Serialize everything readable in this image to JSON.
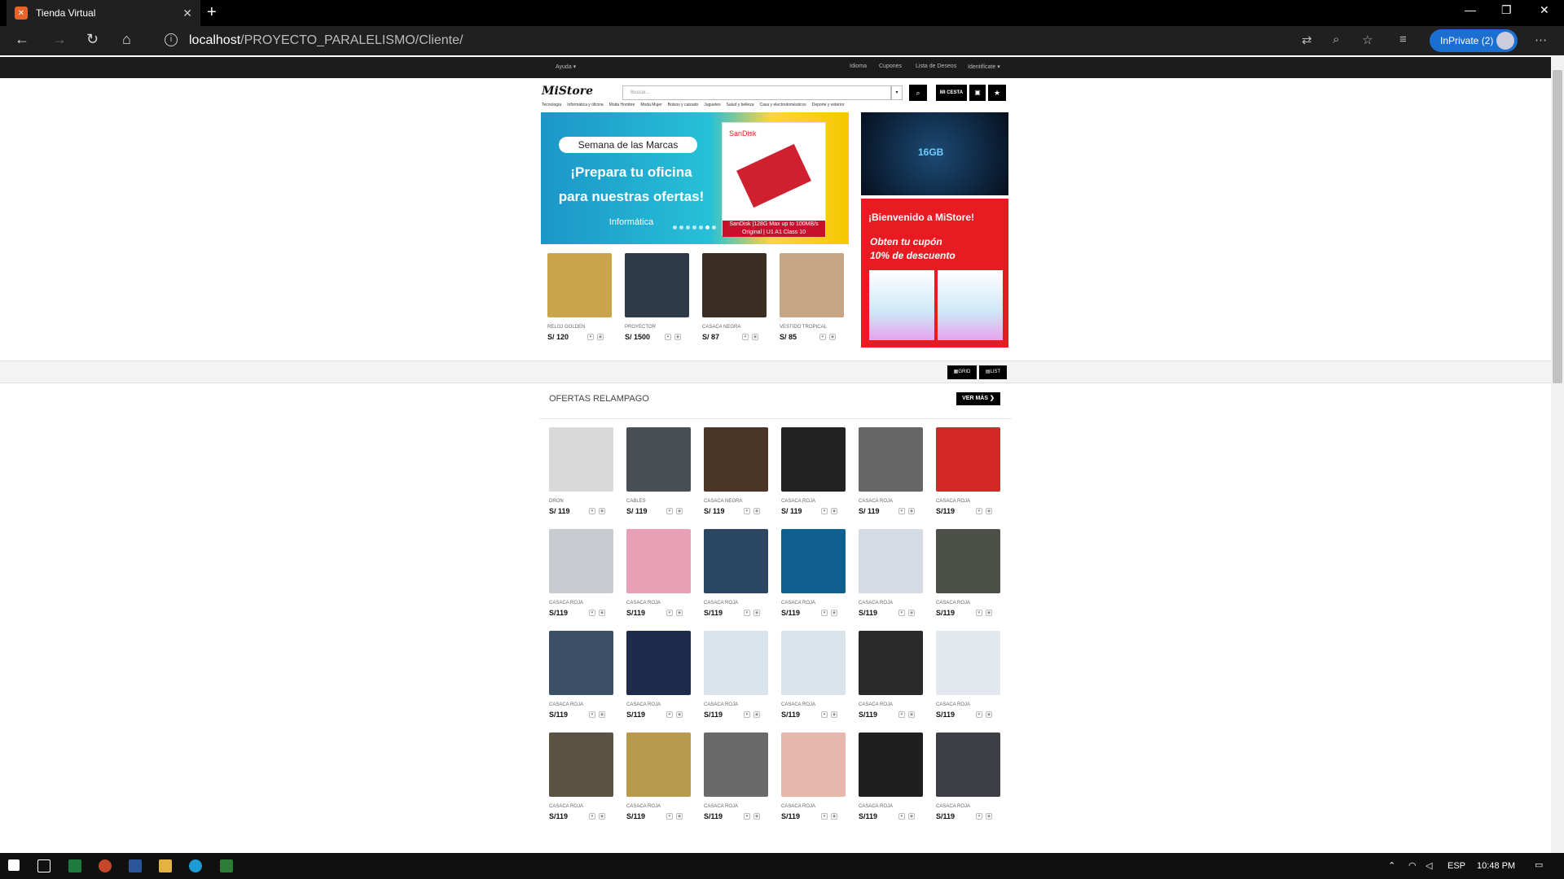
{
  "browser": {
    "tab_title": "Tienda Virtual",
    "url_host": "localhost",
    "url_path": "/PROYECTO_PARALELISMO/Cliente/",
    "inprivate_label": "InPrivate (2)"
  },
  "topbar": {
    "help": "Ayuda ▾",
    "idioma": "Idioma",
    "cupones": "Cupones",
    "deseos": "Lista de Deseos",
    "identificate": "Identifícate ▾"
  },
  "header": {
    "logo": "MiStore",
    "search_placeholder": "Buscar...",
    "cesta_label": "MI CESTA",
    "categories": [
      "Tecnología",
      "Informática y oficina",
      "Moda Hombre",
      "Moda Mujer",
      "Bolsos y calzado",
      "Juguetes",
      "Salud y belleza",
      "Casa y electrodomésticos",
      "Deporte y exterior"
    ]
  },
  "hero": {
    "pill": "Semana de las Marcas",
    "line1": "¡Prepara tu oficina",
    "line2": "para nuestras ofertas!",
    "sub": "Informática",
    "card_brand": "SanDisk",
    "card_caption": "SanDisk |128G Max up to 100MB/s Original | U1 A1 Class 10"
  },
  "side_banner": {
    "tech_text": "16GB",
    "welcome": "¡Bienvenido a MiStore!",
    "coupon_l1": "Obten tu cupón",
    "coupon_l2": "10% de descuento"
  },
  "featured": [
    {
      "name": "RELOJ GOLDEN",
      "price": "S/ 120",
      "color": "#c9a44a"
    },
    {
      "name": "PROYECTOR",
      "price": "S/ 1500",
      "color": "#2e3a48"
    },
    {
      "name": "CASACA NEGRA",
      "price": "S/ 87",
      "color": "#3a2d22"
    },
    {
      "name": "VESTIDO TROPICAL",
      "price": "S/ 85",
      "color": "#c6a583"
    }
  ],
  "controls": {
    "grid": "GRID",
    "list": "LIST"
  },
  "offers": {
    "title": "OFERTAS RELAMPAGO",
    "more": "VER MÁS",
    "rows": [
      [
        {
          "name": "DRON",
          "price": "S/ 119",
          "color": "#d9d9d9"
        },
        {
          "name": "CABLES",
          "price": "S/ 119",
          "color": "#4a4f56"
        },
        {
          "name": "CASACA NEGRA",
          "price": "S/ 119",
          "color": "#4a3526"
        },
        {
          "name": "CASACA ROJA",
          "price": "S/ 119",
          "color": "#222"
        },
        {
          "name": "CASACA ROJA",
          "price": "S/ 119",
          "color": "#666"
        },
        {
          "name": "CASACA ROJA",
          "price": "S/119",
          "color": "#d62727"
        }
      ],
      [
        {
          "name": "CASACA ROJA",
          "price": "S/119",
          "color": "#c8ccd0"
        },
        {
          "name": "CASACA ROJA",
          "price": "S/119",
          "color": "#e8a0b7"
        },
        {
          "name": "CASACA ROJA",
          "price": "S/119",
          "color": "#2b4660"
        },
        {
          "name": "CASACA ROJA",
          "price": "S/119",
          "color": "#10608f"
        },
        {
          "name": "CASACA ROJA",
          "price": "S/119",
          "color": "#d4dbe4"
        },
        {
          "name": "CASACA ROJA",
          "price": "S/119",
          "color": "#4d5048"
        }
      ],
      [
        {
          "name": "CASACA ROJA",
          "price": "S/119",
          "color": "#3b4f66"
        },
        {
          "name": "CASACA ROJA",
          "price": "S/119",
          "color": "#1e2b4a"
        },
        {
          "name": "CASACA ROJA",
          "price": "S/119",
          "color": "#d9e3ec"
        },
        {
          "name": "CASACA ROJA",
          "price": "S/119",
          "color": "#d9e3ec"
        },
        {
          "name": "CASACA ROJA",
          "price": "S/119",
          "color": "#2a2a2a"
        },
        {
          "name": "CASACA ROJA",
          "price": "S/119",
          "color": "#e3e7ee"
        }
      ],
      [
        {
          "name": "CASACA ROJA",
          "price": "S/119",
          "color": "#5a5242"
        },
        {
          "name": "CASACA ROJA",
          "price": "S/119",
          "color": "#b89a4c"
        },
        {
          "name": "CASACA ROJA",
          "price": "S/119",
          "color": "#6a6a6a"
        },
        {
          "name": "CASACA ROJA",
          "price": "S/119",
          "color": "#e6b8ad"
        },
        {
          "name": "CASACA ROJA",
          "price": "S/119",
          "color": "#1f1f1f"
        },
        {
          "name": "CASACA ROJA",
          "price": "S/119",
          "color": "#3d3f44"
        }
      ]
    ]
  },
  "taskbar": {
    "lang": "ESP",
    "time": "10:48 PM"
  }
}
